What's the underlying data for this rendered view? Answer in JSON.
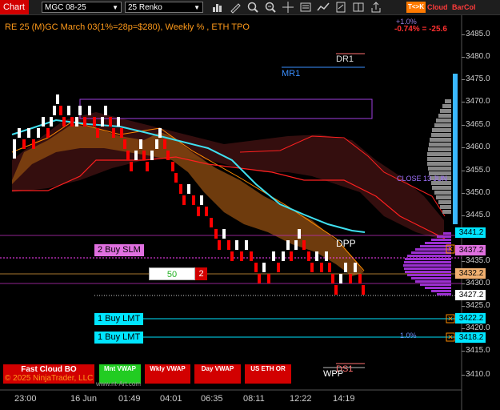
{
  "toolbar": {
    "tab_label": "Chart",
    "instrument": "MGC 08-25",
    "period": "25 Renko",
    "tk_label": "T<>K",
    "cloud_label": "Cloud",
    "barcol_label": "BarCol"
  },
  "chart": {
    "title": "RE 25 (M)GC March 03(1%=28p=$280), Weekly % , ETH TPO",
    "pct_top": "+1.0%",
    "pct_main": "-0.74% = -25.6",
    "levels": {
      "dr1": "DR1",
      "mr1": "MR1",
      "dpp": "DPP",
      "ds1": "DS1",
      "wpp": "WPP",
      "close13": "CLOSE 13 JUN",
      "one_pct": "1.0%"
    },
    "orders": {
      "buy_slm": "2 Buy SLM",
      "qty_field": "50",
      "qty_badge": "2",
      "buy_lmt_1": "1 Buy LMT",
      "buy_lmt_2": "1 Buy LMT"
    },
    "watermark": "© 2025 NinjaTrader, LLC",
    "watermark_url": "www.nt-Art.com"
  },
  "price_axis": {
    "labels": [
      "3485.0",
      "3480.0",
      "3475.0",
      "3470.0",
      "3465.0",
      "3460.0",
      "3455.0",
      "3450.0",
      "3445.0",
      "3435.0",
      "3430.0",
      "3425.0",
      "3420.0",
      "3415.0",
      "3410.0"
    ],
    "tags": [
      {
        "text": "3441.2",
        "bg": "#00e5ff"
      },
      {
        "text": "3437.2",
        "bg": "#e070e0"
      },
      {
        "text": "3432.2",
        "bg": "#f0b070"
      },
      {
        "text": "3427.2",
        "bg": "#ffffff"
      },
      {
        "text": "3422.2",
        "bg": "#00e5ff"
      },
      {
        "text": "3418.2",
        "bg": "#00e5ff"
      }
    ]
  },
  "time_axis": [
    "23:00",
    "16 Jun",
    "01:49",
    "04:01",
    "06:35",
    "08:11",
    "12:22",
    "14:19"
  ],
  "bottom_buttons": [
    {
      "label": "Fast Cloud BO",
      "color": "#d20000"
    },
    {
      "label": "Mnt VWAP",
      "color": "#22cc22"
    },
    {
      "label": "Wkly VWAP",
      "color": "#d20000"
    },
    {
      "label": "Day VWAP",
      "color": "#d20000"
    },
    {
      "label": "US ETH OR",
      "color": "#d20000"
    }
  ],
  "colors": {
    "up": "#ffffff",
    "down": "#ff0000",
    "accent": "#00e5ff",
    "cloud": "#ff8c00",
    "profile": "#9b30d0"
  }
}
